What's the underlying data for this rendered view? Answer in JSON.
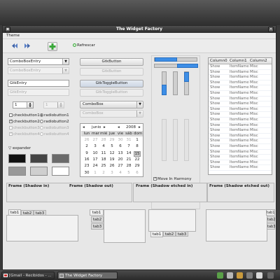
{
  "window": {
    "title": "The Widget Factory"
  },
  "menubar": {
    "theme": "Theme"
  },
  "toolbar": {
    "refresh_label": "Refrescar"
  },
  "left": {
    "combo_entry": "ComboBoxEntry",
    "combo_entry_dis": "ComboBoxEntry",
    "entry": "GtkEntry",
    "entry_dis": "GtkEntry",
    "spin1": "1",
    "spin2": "1",
    "checkbuttons": [
      "checkbutton1",
      "checkbutton2",
      "checkbutton3",
      "checkbutton4"
    ],
    "radiobuttons": [
      "radiobutton1",
      "radiobutton2",
      "radiobutton3",
      "radiobutton4"
    ],
    "expander": "expander"
  },
  "middle": {
    "button": "GtkButton",
    "button_dis": "GtkButton",
    "toggle": "GtkToggleButton",
    "toggle_dis": "GtkToggleButton",
    "combo": "ComboBox",
    "combo_dis": "ComboBox",
    "calendar": {
      "month": "junio",
      "year": "2008",
      "weekdays": [
        "lun",
        "mar",
        "mié",
        "jue",
        "vie",
        "sáb",
        "dom"
      ],
      "rows": [
        [
          "26",
          "27",
          "28",
          "29",
          "30",
          "31",
          "1"
        ],
        [
          "2",
          "3",
          "4",
          "5",
          "6",
          "7",
          "8"
        ],
        [
          "9",
          "10",
          "11",
          "12",
          "13",
          "14",
          "15"
        ],
        [
          "16",
          "17",
          "18",
          "19",
          "20",
          "21",
          "22"
        ],
        [
          "23",
          "24",
          "25",
          "26",
          "27",
          "28",
          "29"
        ],
        [
          "30",
          "1",
          "2",
          "3",
          "4",
          "5",
          "6"
        ]
      ]
    }
  },
  "sliders": {
    "move_label": "Move In Harmony"
  },
  "tree": {
    "columns": [
      "Column0",
      "Column1",
      "Column2"
    ],
    "rows": [
      [
        "Show",
        "ItemName",
        "Misc"
      ],
      [
        "Show",
        "ItemName",
        "Misc"
      ],
      [
        "Show",
        "ItemName",
        "Misc"
      ],
      [
        "Show",
        "ItemName",
        "Misc"
      ],
      [
        "Show",
        "ItemName",
        "Misc"
      ],
      [
        "Show",
        "ItemName",
        "Misc"
      ],
      [
        "Show",
        "ItemName",
        "Misc"
      ],
      [
        "Show",
        "ItemName",
        "Misc"
      ],
      [
        "Show",
        "ItemName",
        "Misc"
      ],
      [
        "Show",
        "ItemName",
        "Misc"
      ],
      [
        "Show",
        "ItemName",
        "Misc"
      ],
      [
        "Show",
        "ItemName",
        "Misc"
      ],
      [
        "Show",
        "ItemName",
        "Misc"
      ],
      [
        "Show",
        "ItemName",
        "Misc"
      ],
      [
        "Show",
        "ItemName",
        "Misc"
      ],
      [
        "Show",
        "ItemName",
        "Misc"
      ],
      [
        "Show",
        "ItemName",
        "Misc"
      ],
      [
        "Show",
        "ItemName",
        "Misc"
      ],
      [
        "Show",
        "ItemName",
        "Misc"
      ],
      [
        "Show",
        "ItemName",
        "Misc"
      ]
    ]
  },
  "frames": [
    "Frame (Shadow in)",
    "Frame (Shadow out)",
    "Frame (Shadow etched in)",
    "Frame (Shadow etched out)"
  ],
  "notebooks": {
    "tabs": [
      "tab1",
      "tab2",
      "tab3"
    ]
  },
  "taskbar": {
    "items": [
      "[Gmail - Recibidos - ...",
      "The Widget Factory"
    ]
  },
  "colors": {
    "accent": "#3d8ee6",
    "window_bg": "#e7e7e7",
    "titlebar": "#333333"
  }
}
